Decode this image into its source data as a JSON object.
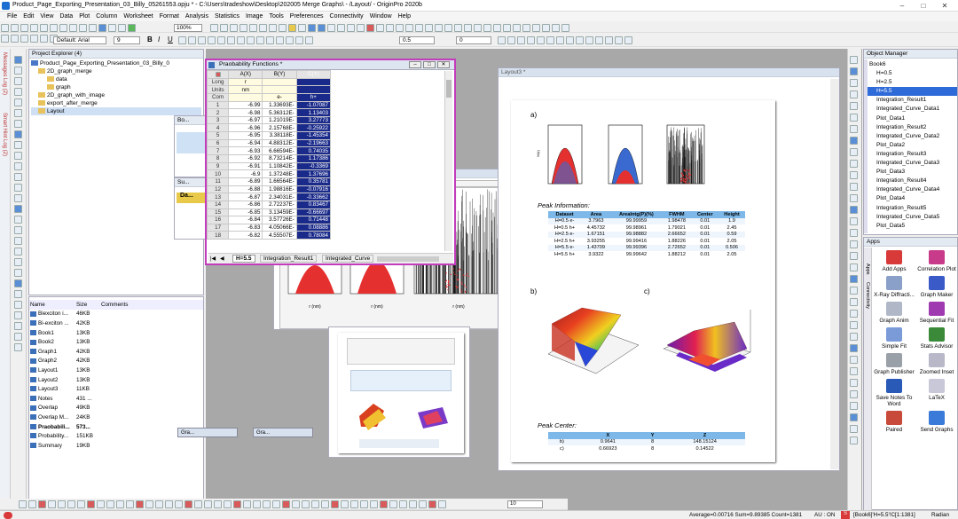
{
  "app": {
    "title": "Product_Page_Exporting_Presentation_03_Billy_05261553.opju * - C:\\Users\\tradeshow\\Desktop\\202005 Merge Graphs\\ - /Layout/ - OriginPro 2020b"
  },
  "menu": [
    "File",
    "Edit",
    "View",
    "Data",
    "Plot",
    "Column",
    "Worksheet",
    "Format",
    "Analysis",
    "Statistics",
    "Image",
    "Tools",
    "Preferences",
    "Connectivity",
    "Window",
    "Help"
  ],
  "toolbar": {
    "zoom": "100%",
    "font": "Default: Arial",
    "font_size": "9",
    "line_width": "0.5",
    "offset": "0"
  },
  "left_strip": [
    "Messages Log (2)",
    "Smart Hint Log (2)"
  ],
  "project_explorer": {
    "title": "Project Explorer (4)",
    "root": "Product_Page_Exporting_Presentation_03_Billy_0",
    "folders": [
      "2D_graph_merge",
      "data",
      "graph",
      "2D_graph_with_image",
      "export_after_merge",
      "Layout"
    ],
    "columns": [
      "Name",
      "Size",
      "Comments"
    ],
    "files": [
      {
        "name": "Biexciton i...",
        "size": "46KB"
      },
      {
        "name": "Bi-exciton ...",
        "size": "42KB"
      },
      {
        "name": "Book1",
        "size": "13KB"
      },
      {
        "name": "Book2",
        "size": "13KB"
      },
      {
        "name": "Graph1",
        "size": "42KB"
      },
      {
        "name": "Graph2",
        "size": "42KB"
      },
      {
        "name": "Layout1",
        "size": "13KB"
      },
      {
        "name": "Layout2",
        "size": "13KB"
      },
      {
        "name": "Layout3",
        "size": "11KB"
      },
      {
        "name": "Notes",
        "size": "431 ..."
      },
      {
        "name": "Overlap",
        "size": "49KB"
      },
      {
        "name": "Overlap M...",
        "size": "24KB"
      },
      {
        "name": "Praobabili...",
        "size": "573..."
      },
      {
        "name": "Probability...",
        "size": "151KB"
      },
      {
        "name": "Summary",
        "size": "19KB"
      }
    ]
  },
  "worksheet": {
    "title": "Praobability Functions *",
    "columns": [
      "A(X)",
      "B(Y)",
      "C(Y)"
    ],
    "long_name": [
      "r",
      "",
      ""
    ],
    "units": [
      "nm",
      "",
      ""
    ],
    "comments": [
      "",
      "e-",
      "h+"
    ],
    "row_labels": [
      "Long",
      "Units",
      "Com"
    ],
    "rows": [
      [
        "1",
        "-6.99",
        "1.33693E-",
        "-1.07087"
      ],
      [
        "2",
        "-6.98",
        "5.36312E-",
        "1.13403"
      ],
      [
        "3",
        "-6.97",
        "1.21019E-",
        "3.27773"
      ],
      [
        "4",
        "-6.96",
        "2.15768E-",
        "-0.25922"
      ],
      [
        "5",
        "-6.95",
        "3.38118E-",
        "-1.45354"
      ],
      [
        "6",
        "-6.94",
        "4.88312E-",
        "-2.19663"
      ],
      [
        "7",
        "-6.93",
        "6.66594E-",
        "0.74035"
      ],
      [
        "8",
        "-6.92",
        "8.73214E-",
        "1.17386"
      ],
      [
        "9",
        "-6.91",
        "1.10842E-",
        "-0.3369"
      ],
      [
        "10",
        "-6.9",
        "1.37248E-",
        "1.37696"
      ],
      [
        "11",
        "-6.89",
        "1.66564E-",
        "0.35781"
      ],
      [
        "12",
        "-6.88",
        "1.98816E-",
        "-0.07916"
      ],
      [
        "13",
        "-6.87",
        "2.34031E-",
        "-0.33662"
      ],
      [
        "14",
        "-6.86",
        "2.72237E-",
        "0.83467"
      ],
      [
        "15",
        "-6.85",
        "3.13459E-",
        "-0.66697"
      ],
      [
        "16",
        "-6.84",
        "3.57726E-",
        "0.71448"
      ],
      [
        "17",
        "-6.83",
        "4.05066E-",
        "0.08886"
      ],
      [
        "18",
        "-6.82",
        "4.55507E-",
        "0.78084"
      ]
    ],
    "tabs": [
      "H=5.5",
      "Integration_Result1",
      "Integrated_Curve"
    ]
  },
  "layout": {
    "title": "Layout3 *",
    "label_a": "a)",
    "label_b": "b)",
    "label_c": "c)",
    "peak_info_title": "Peak Information:",
    "peak_info_columns": [
      "Dataset",
      "Area",
      "AreaIntg(P)(%)",
      "FWHM",
      "Center",
      "Height"
    ],
    "peak_info_rows": [
      [
        "H=0.5 e-",
        "3.7963",
        "99.99959",
        "1.98478",
        "0.01",
        "1.9"
      ],
      [
        "H=0.5 h+",
        "4.45732",
        "99.98961",
        "1.79021",
        "0.01",
        "2.45"
      ],
      [
        "H=2.5 e-",
        "1.67151",
        "99.98882",
        "2.66652",
        "0.01",
        "0.59"
      ],
      [
        "H=2.5 h+",
        "3.93255",
        "99.99416",
        "1.88226",
        "0.01",
        "2.05"
      ],
      [
        "H=5.5 e-",
        "1.43709",
        "99.99396",
        "2.72652",
        "0.01",
        "0.506"
      ],
      [
        "H=5.5 h+",
        "3.9322",
        "99.99642",
        "1.88212",
        "0.01",
        "2.05"
      ]
    ],
    "peak_center_title": "Peak Center:",
    "peak_center_columns": [
      "",
      "X",
      "Y",
      "Z"
    ],
    "peak_center_rows": [
      [
        "b)",
        "0.9641",
        "8",
        "148.15124"
      ],
      [
        "c)",
        "0.66923",
        "8",
        "0.14522"
      ]
    ],
    "axis_r": "r (nm)"
  },
  "object_manager": {
    "title": "Object Manager",
    "items": [
      "Book6",
      "H=0.5",
      "H=2.5",
      "H=5.5",
      "Integration_Result1",
      "Integrated_Curve_Data1",
      "Plot_Data1",
      "Integration_Result2",
      "Integrated_Curve_Data2",
      "Plot_Data2",
      "Integration_Result3",
      "Integrated_Curve_Data3",
      "Plot_Data3",
      "Integration_Result4",
      "Integrated_Curve_Data4",
      "Plot_Data4",
      "Integration_Result5",
      "Integrated_Curve_Data5",
      "Plot_Data5"
    ]
  },
  "apps": {
    "title": "Apps",
    "items": [
      {
        "label": "Add Apps",
        "color": "#d83a3a"
      },
      {
        "label": "Correlation Plot",
        "color": "#c83a8a"
      },
      {
        "label": "X-Ray Diffracti...",
        "color": "#8aa0c8"
      },
      {
        "label": "Graph Maker",
        "color": "#3a5ac8"
      },
      {
        "label": "Graph Anim",
        "color": "#b0b8c8"
      },
      {
        "label": "Sequential Fit",
        "color": "#a03ab0"
      },
      {
        "label": "Simple Fit",
        "color": "#7a9ad8"
      },
      {
        "label": "Stats Advisor",
        "color": "#3a8a3a"
      },
      {
        "label": "Graph Publisher",
        "color": "#9aa0a8"
      },
      {
        "label": "Zoomed Inset",
        "color": "#b8b8c8"
      },
      {
        "label": "Save Notes To Word",
        "color": "#2a5ab8"
      },
      {
        "label": "LaTeX",
        "color": "#c8c8d8"
      },
      {
        "label": "Paired",
        "color": "#c84a3a"
      },
      {
        "label": "Send Graphs",
        "color": "#3a7ad8"
      }
    ],
    "side_tabs": [
      "Apps",
      "Connectivity"
    ]
  },
  "minimized": [
    "Bo...",
    "Su...",
    "Da...",
    "Gra...",
    "Gra..."
  ],
  "status": {
    "stats": "Average=0.00716 Sum=9.89385 Count=1381",
    "mode": "AU : ON",
    "book": "[Book6]'H=5.5'!C[1:1381]",
    "unit": "Radian"
  },
  "bottom_toolbar": {
    "size": "10"
  }
}
